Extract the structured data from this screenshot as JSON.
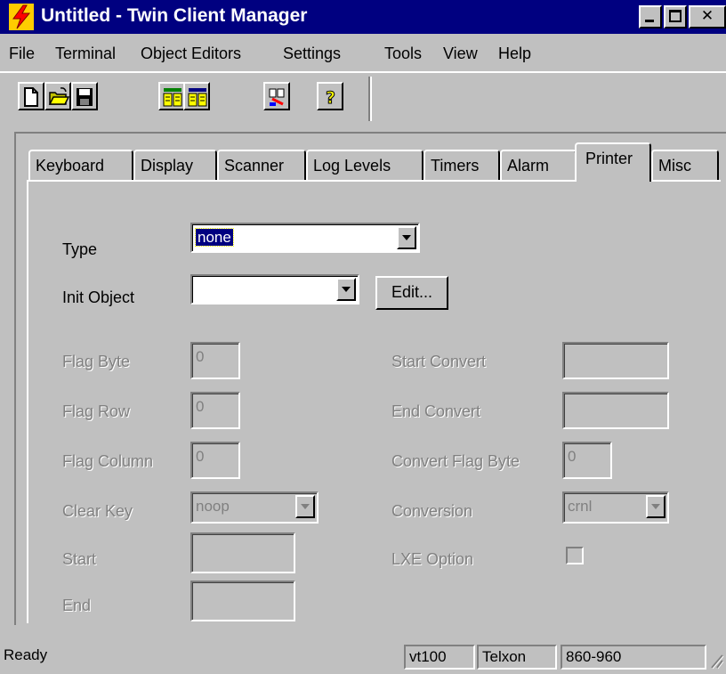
{
  "window": {
    "title": "Untitled - Twin Client Manager",
    "app_icon": "lightning-bolt-icon",
    "controls": [
      "minimize-icon",
      "maximize-icon",
      "close-icon"
    ]
  },
  "menu": {
    "items": [
      "File",
      "Terminal",
      "Object Editors",
      "Settings",
      "Tools",
      "View",
      "Help"
    ]
  },
  "toolbar": {
    "buttons": [
      "new-document-icon",
      "open-folder-icon",
      "save-disk-icon",
      "object-editor-1-icon",
      "object-editor-2-icon",
      "download-icon",
      "help-icon"
    ]
  },
  "tabs": {
    "items": [
      "Keyboard",
      "Display",
      "Scanner",
      "Log Levels",
      "Timers",
      "Alarm",
      "Printer",
      "Misc"
    ],
    "active": "Printer"
  },
  "printer": {
    "type_label": "Type",
    "type_value": "none",
    "init_object_label": "Init Object",
    "init_object_value": "",
    "edit_button": "Edit...",
    "flag_byte_label": "Flag Byte",
    "flag_byte_value": "0",
    "flag_row_label": "Flag Row",
    "flag_row_value": "0",
    "flag_column_label": "Flag Column",
    "flag_column_value": "0",
    "clear_key_label": "Clear Key",
    "clear_key_value": "noop",
    "start_label": "Start",
    "start_value": "",
    "end_label": "End",
    "end_value": "",
    "start_convert_label": "Start Convert",
    "start_convert_value": "",
    "end_convert_label": "End Convert",
    "end_convert_value": "",
    "convert_flag_byte_label": "Convert Flag Byte",
    "convert_flag_byte_value": "0",
    "conversion_label": "Conversion",
    "conversion_value": "crnl",
    "lxe_option_label": "LXE Option",
    "lxe_option_checked": false
  },
  "status": {
    "message": "Ready",
    "terminal": "vt100",
    "vendor": "Telxon",
    "model": "860-960"
  },
  "colors": {
    "face": "#c0c0c0",
    "titlebar": "#000080",
    "selection": "#000080",
    "disabled_text": "#808080"
  }
}
